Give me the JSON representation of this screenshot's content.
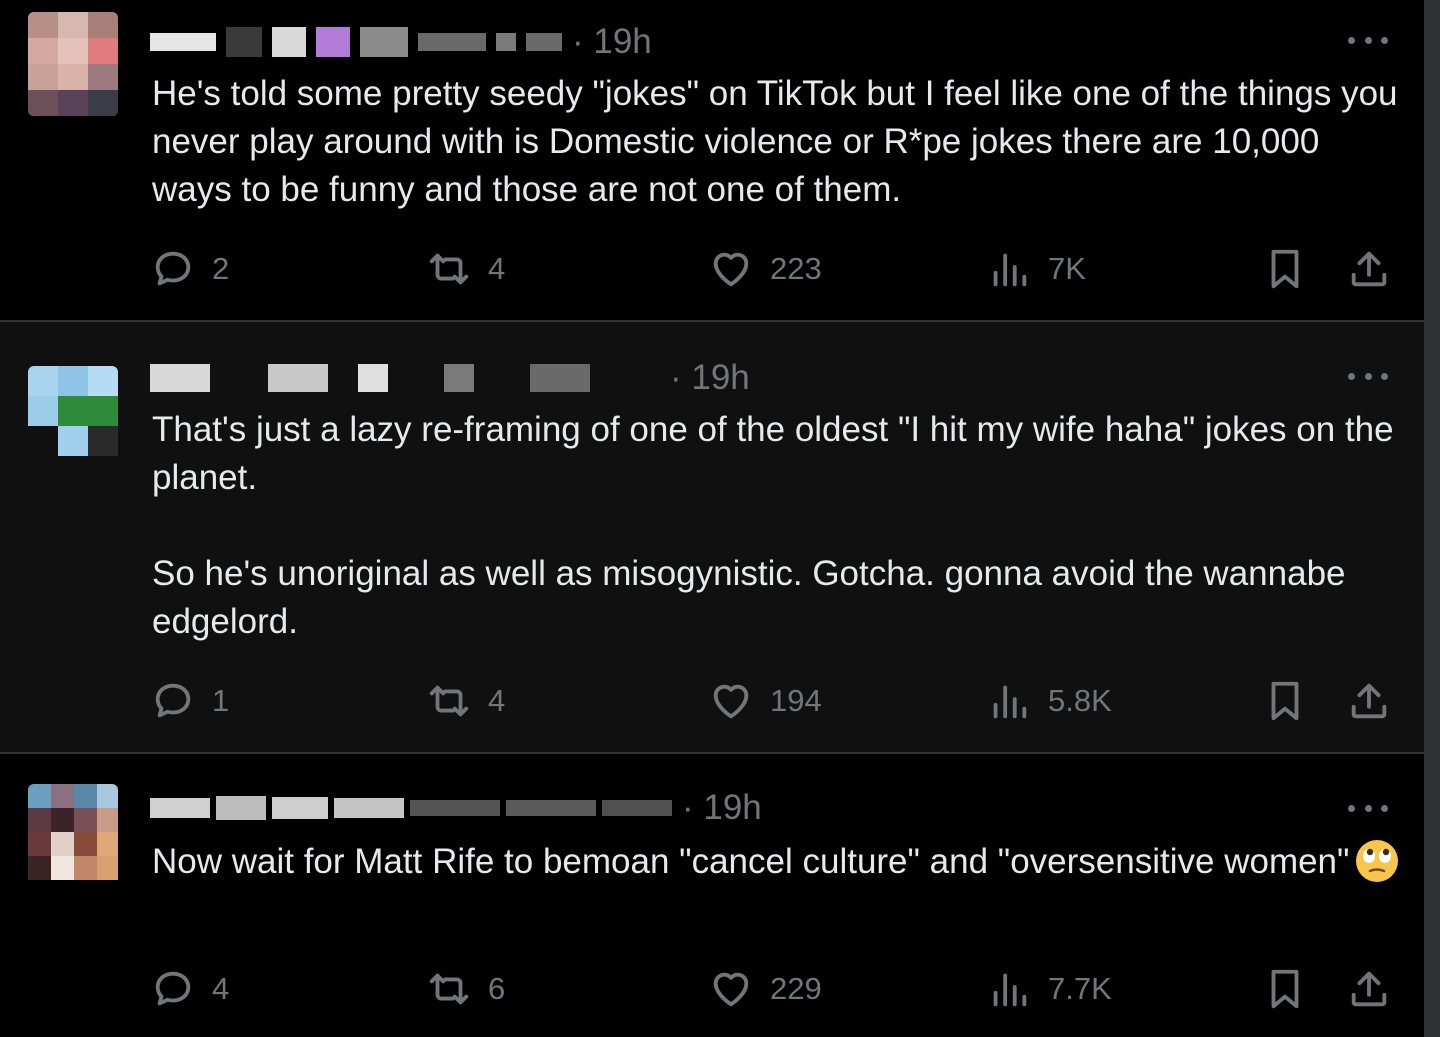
{
  "tweets": [
    {
      "time": "· 19h",
      "text": [
        "He's told some pretty seedy \"jokes\" on TikTok but I feel like one of the things you never play around with is Domestic violence or R*pe jokes there are 10,000 ways to be funny and those are not one of them."
      ],
      "stats": {
        "replies": "2",
        "reposts": "4",
        "likes": "223",
        "views": "7K"
      }
    },
    {
      "time": "· 19h",
      "text": [
        "That's just a lazy re-framing of one of the oldest \"I hit my wife haha\" jokes on the planet.",
        "So he's unoriginal as well as misogynistic. Gotcha. gonna avoid the wannabe edgelord."
      ],
      "stats": {
        "replies": "1",
        "reposts": "4",
        "likes": "194",
        "views": "5.8K"
      }
    },
    {
      "time": "· 19h",
      "text": [
        "Now wait for Matt Rife to bemoan \"cancel culture\" and \"oversensitive women\""
      ],
      "emoji": "face-with-rolling-eyes",
      "stats": {
        "replies": "4",
        "reposts": "6",
        "likes": "229",
        "views": "7.7K"
      }
    }
  ],
  "icons": [
    "reply-icon",
    "repost-icon",
    "like-icon",
    "views-icon",
    "bookmark-icon",
    "share-icon",
    "more-icon"
  ],
  "colors": {
    "background": "#000000",
    "alt_background": "#101010",
    "text": "#e7e9ea",
    "muted": "#71767b",
    "border": "#2f3336"
  }
}
